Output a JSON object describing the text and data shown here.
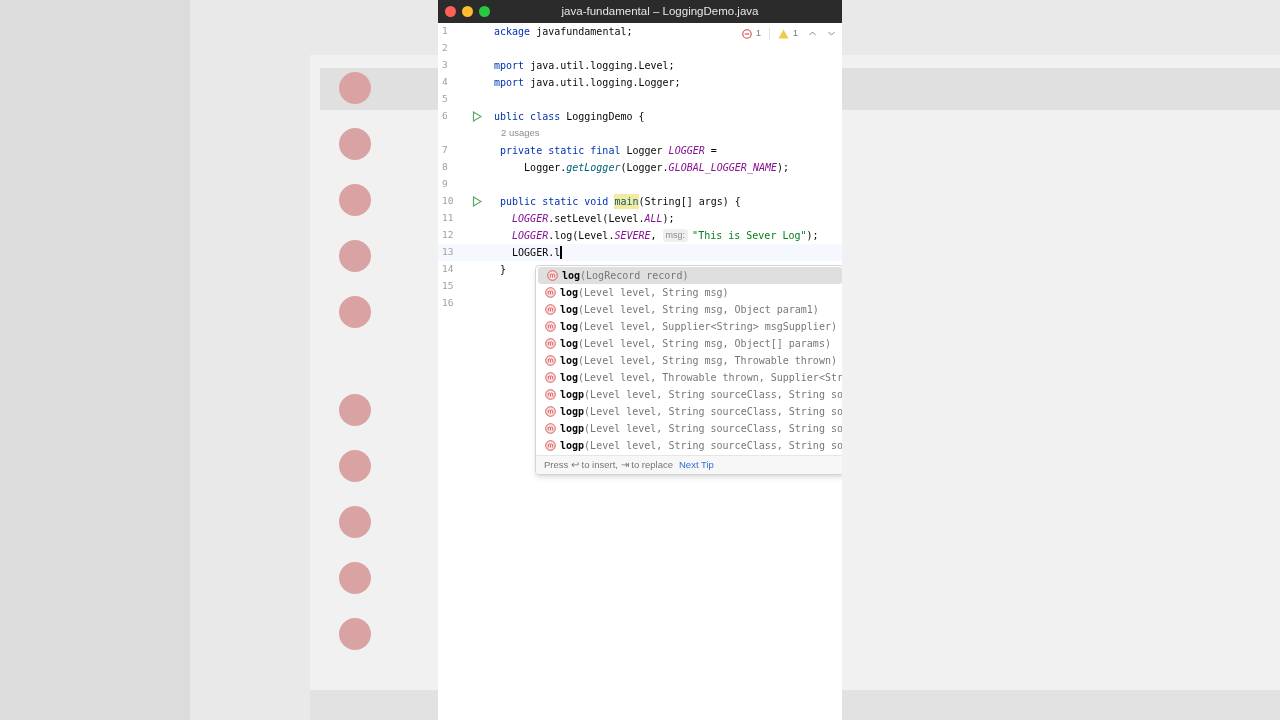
{
  "window": {
    "title": "java-fundamental – LoggingDemo.java"
  },
  "inspections": {
    "errors": "1",
    "warnings": "1"
  },
  "lines": [
    {
      "kind": "code",
      "number": "1",
      "run": false,
      "current": false,
      "tokens": [
        {
          "kind": "keyword",
          "text": "ackage "
        },
        {
          "kind": "plain",
          "text": "javafundamental;"
        }
      ]
    },
    {
      "kind": "code",
      "number": "2",
      "run": false,
      "current": false
    },
    {
      "kind": "code",
      "number": "3",
      "run": false,
      "current": false,
      "tokens": [
        {
          "kind": "keyword",
          "text": "mport "
        },
        {
          "kind": "plain",
          "text": "java.util.logging.Level;"
        }
      ]
    },
    {
      "kind": "code",
      "number": "4",
      "run": false,
      "current": false,
      "tokens": [
        {
          "kind": "keyword",
          "text": "mport "
        },
        {
          "kind": "plain",
          "text": "java.util.logging.Logger;"
        }
      ]
    },
    {
      "kind": "code",
      "number": "5",
      "run": false,
      "current": false
    },
    {
      "kind": "code",
      "number": "6",
      "run": true,
      "current": false,
      "tokens": [
        {
          "kind": "keyword",
          "text": "ublic class "
        },
        {
          "kind": "plain",
          "text": "LoggingDemo {"
        }
      ]
    },
    {
      "kind": "inlay",
      "text": "2 usages"
    },
    {
      "kind": "code",
      "number": "7",
      "run": false,
      "current": false,
      "tokens": [
        {
          "kind": "keyword",
          "text": " private static final "
        },
        {
          "kind": "plain",
          "text": "Logger "
        },
        {
          "kind": "static",
          "text": "LOGGER"
        },
        {
          "kind": "plain",
          "text": " ="
        }
      ]
    },
    {
      "kind": "code",
      "number": "8",
      "run": false,
      "current": false,
      "tokens": [
        {
          "kind": "plain",
          "text": "     Logger."
        },
        {
          "kind": "method",
          "text": "getLogger"
        },
        {
          "kind": "plain",
          "text": "(Logger."
        },
        {
          "kind": "static",
          "text": "GLOBAL_LOGGER_NAME"
        },
        {
          "kind": "plain",
          "text": ");"
        }
      ]
    },
    {
      "kind": "code",
      "number": "9",
      "run": false,
      "current": false
    },
    {
      "kind": "code",
      "number": "10",
      "run": true,
      "current": false,
      "tokens": [
        {
          "kind": "keyword",
          "text": " public static void "
        },
        {
          "kind": "decl",
          "text": "main"
        },
        {
          "kind": "plain",
          "text": "(String[] args) {"
        }
      ]
    },
    {
      "kind": "code",
      "number": "11",
      "run": false,
      "current": false,
      "tokens": [
        {
          "kind": "static",
          "text": "   LOGGER"
        },
        {
          "kind": "plain",
          "text": ".setLevel(Level."
        },
        {
          "kind": "static",
          "text": "ALL"
        },
        {
          "kind": "plain",
          "text": ");"
        }
      ]
    },
    {
      "kind": "code",
      "number": "12",
      "run": false,
      "current": false,
      "tokens": [
        {
          "kind": "static",
          "text": "   LOGGER"
        },
        {
          "kind": "plain",
          "text": ".log(Level."
        },
        {
          "kind": "static",
          "text": "SEVERE"
        },
        {
          "kind": "plain",
          "text": ", "
        },
        {
          "kind": "hint",
          "text": "msg:"
        },
        {
          "kind": "string",
          "text": "\"This is Sever Log\""
        },
        {
          "kind": "plain",
          "text": ");"
        }
      ]
    },
    {
      "kind": "code",
      "number": "13",
      "run": false,
      "current": true,
      "tokens": [
        {
          "kind": "plain",
          "text": "   LOGGER.l"
        }
      ]
    },
    {
      "kind": "code",
      "number": "14",
      "run": false,
      "current": false,
      "tokens": [
        {
          "kind": "plain",
          "text": " }"
        }
      ]
    },
    {
      "kind": "code",
      "number": "15",
      "run": false,
      "current": false
    },
    {
      "kind": "code",
      "number": "16",
      "run": false,
      "current": false
    }
  ],
  "popup": {
    "items": [
      {
        "name": "log",
        "params": "(LogRecord record)",
        "selected": true
      },
      {
        "name": "log",
        "params": "(Level level, String msg)",
        "selected": false
      },
      {
        "name": "log",
        "params": "(Level level, String msg, Object param1)",
        "selected": false
      },
      {
        "name": "log",
        "params": "(Level level, Supplier<String> msgSupplier)",
        "selected": false
      },
      {
        "name": "log",
        "params": "(Level level, String msg, Object[] params)",
        "selected": false
      },
      {
        "name": "log",
        "params": "(Level level, String msg, Throwable thrown)",
        "selected": false
      },
      {
        "name": "log",
        "params": "(Level level, Throwable thrown, Supplier<Str",
        "selected": false
      },
      {
        "name": "logp",
        "params": "(Level level, String sourceClass, String so",
        "selected": false
      },
      {
        "name": "logp",
        "params": "(Level level, String sourceClass, String so",
        "selected": false
      },
      {
        "name": "logp",
        "params": "(Level level, String sourceClass, String so",
        "selected": false
      },
      {
        "name": "logp",
        "params": "(Level level, String sourceClass, String so",
        "selected": false
      }
    ],
    "footer": {
      "hint": "Press ↩ to insert, ⇥ to replace",
      "link": "Next Tip"
    }
  }
}
